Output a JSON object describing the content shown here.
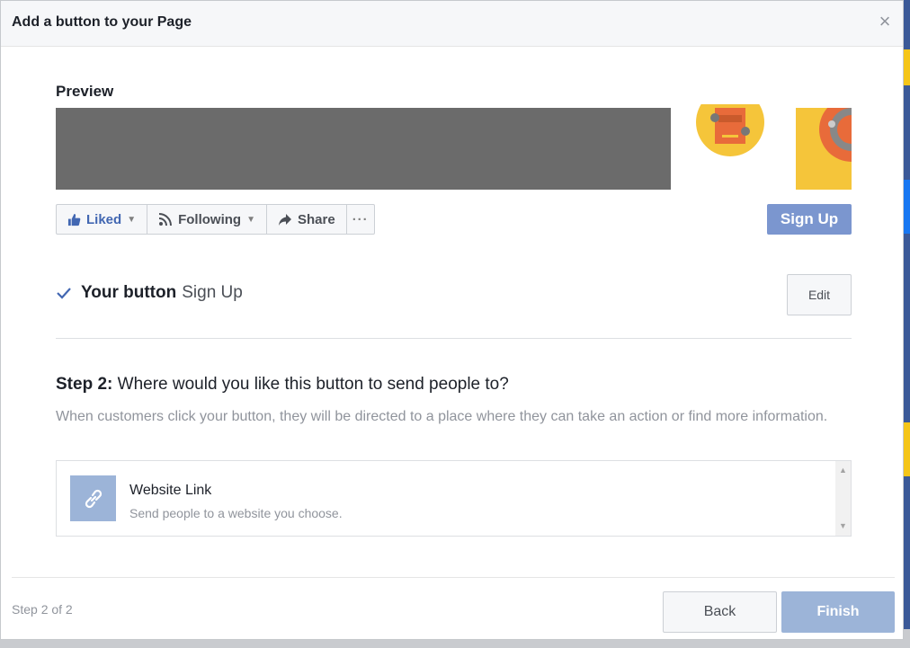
{
  "dialog": {
    "title": "Add a button to your Page"
  },
  "preview": {
    "heading": "Preview",
    "actions": [
      {
        "label": "Liked",
        "icon": "thumbs-up-icon"
      },
      {
        "label": "Following",
        "icon": "rss-icon"
      },
      {
        "label": "Share",
        "icon": "share-arrow-icon"
      },
      {
        "label": "···",
        "icon": "more-icon"
      }
    ],
    "cta_label": "Sign Up"
  },
  "your_button": {
    "label": "Your button",
    "value": "Sign Up",
    "edit_label": "Edit"
  },
  "step2": {
    "prefix": "Step 2:",
    "question": " Where would you like this button to send people to?",
    "description": "When customers click your button, they will be directed to a place where they can take an action or find more information."
  },
  "options": [
    {
      "title": "Website Link",
      "subtitle": "Send people to a website you choose.",
      "icon": "link-icon"
    }
  ],
  "footer": {
    "step_count": "Step 2 of 2",
    "back_label": "Back",
    "finish_label": "Finish"
  },
  "colors": {
    "brand": "#4267b2",
    "cta_disabled": "#7b96cf",
    "finish_disabled": "#9cb4d8"
  }
}
